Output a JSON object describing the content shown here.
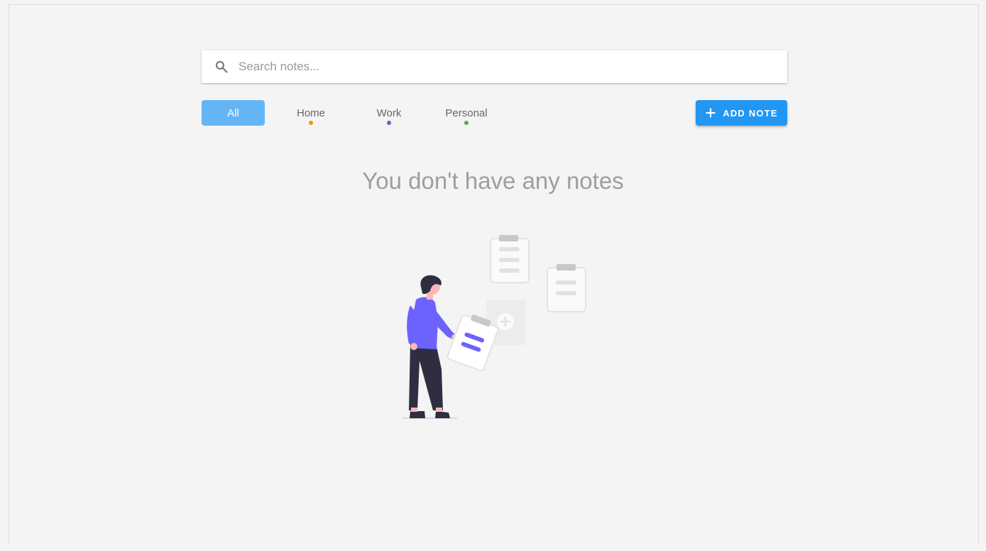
{
  "search": {
    "placeholder": "Search notes..."
  },
  "filters": {
    "tabs": [
      {
        "label": "All",
        "active": true,
        "dot_color": null
      },
      {
        "label": "Home",
        "active": false,
        "dot_color": "#f59300"
      },
      {
        "label": "Work",
        "active": false,
        "dot_color": "#5c6bc0"
      },
      {
        "label": "Personal",
        "active": false,
        "dot_color": "#4caf50"
      }
    ]
  },
  "toolbar": {
    "add_note_label": "ADD NOTE"
  },
  "empty_state": {
    "message": "You don't have any notes",
    "illustration": "person-holding-clipboard-illustration"
  },
  "colors": {
    "primary": "#2196f3",
    "active_tab": "#64b5f6",
    "background": "#f4f4f4",
    "illustration_accent": "#6c63ff"
  },
  "icons": {
    "search": "search-icon",
    "add": "plus-icon"
  }
}
